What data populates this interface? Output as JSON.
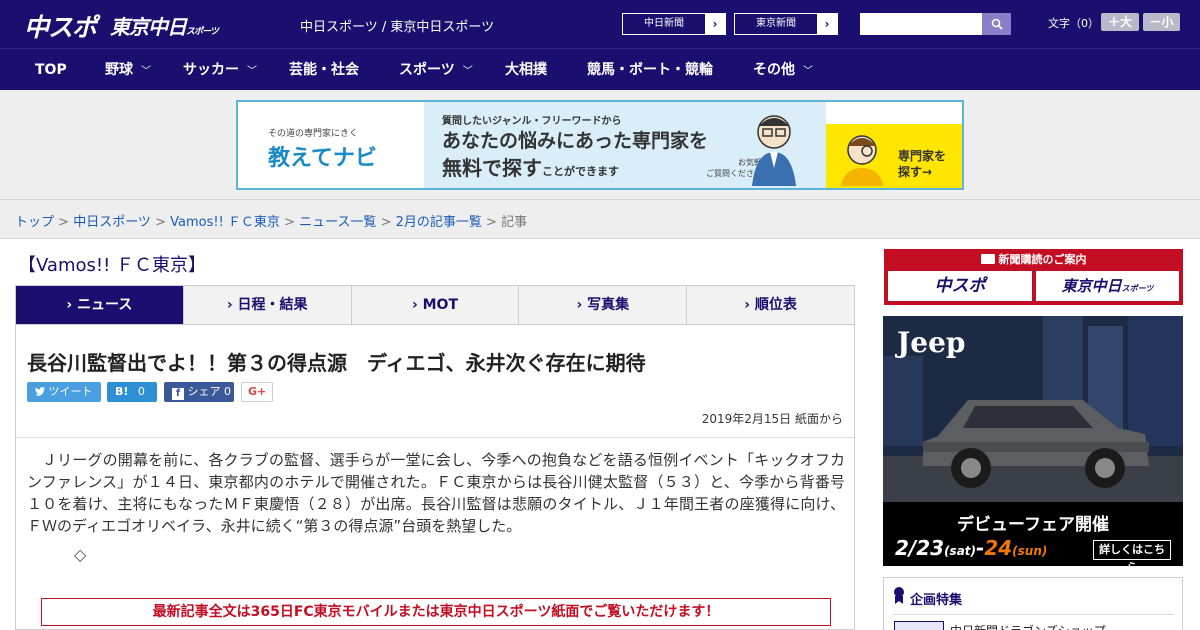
{
  "header": {
    "logo_chuspo": "中スポ",
    "logo_tokyo": "東京中日",
    "logo_tokyo_small": "スポーツ",
    "site_name": "中日スポーツ / 東京中日スポーツ",
    "links": [
      {
        "label": "中日新聞",
        "arrow": "›"
      },
      {
        "label": "東京新聞",
        "arrow": "›"
      }
    ],
    "search_placeholder": "",
    "font_label": "文字（0）",
    "font_larger": "＋大",
    "font_smaller": "－小"
  },
  "nav": {
    "items": [
      {
        "label": "TOP",
        "has_menu": false
      },
      {
        "label": "野球",
        "has_menu": true
      },
      {
        "label": "サッカー",
        "has_menu": true
      },
      {
        "label": "芸能・社会",
        "has_menu": false
      },
      {
        "label": "スポーツ",
        "has_menu": true
      },
      {
        "label": "大相撲",
        "has_menu": false
      },
      {
        "label": "競馬・ボート・競輪",
        "has_menu": false
      },
      {
        "label": "その他",
        "has_menu": true
      }
    ],
    "chevron": "﹀"
  },
  "ad_banner": {
    "tagline": "その道の専門家にきく",
    "brand": "教えてナビ",
    "line1": "質問したいジャンル・フリーワードから",
    "line2": "あなたの悩みにあった専門家を",
    "line3_main": "無料で探す",
    "line3_small": "ことができます",
    "note": "お気軽に\nご質問ください！",
    "cta": "専門家を\n探す→"
  },
  "breadcrumb": {
    "items": [
      "トップ",
      "中日スポーツ",
      "Vamos!! ＦＣ東京",
      "ニュース一覧",
      "2月の記事一覧"
    ],
    "current": "記事",
    "separator": " > "
  },
  "section": {
    "title": "【Vamos!! ＦＣ東京】"
  },
  "tabs": [
    {
      "label": "ニュース",
      "active": true
    },
    {
      "label": "日程・結果",
      "active": false
    },
    {
      "label": "MOT",
      "active": false
    },
    {
      "label": "写真集",
      "active": false
    },
    {
      "label": "順位表",
      "active": false
    }
  ],
  "tab_marker": "›",
  "article": {
    "title": "長谷川監督出でよ！！第３の得点源　ディエゴ、永井次ぐ存在に期待",
    "share": {
      "tweet": "ツイート",
      "hatena_count": "0",
      "facebook": "シェア",
      "facebook_count": "0",
      "gplus": "G+"
    },
    "date": "2019年2月15日 紙面から",
    "body": "Ｊリーグの開幕を前に、各クラブの監督、選手らが一堂に会し、今季への抱負などを語る恒例イベント「キックオフカンファレンス」が１４日、東京都内のホテルで開催された。ＦＣ東京からは長谷川健太監督（５３）と、今季から背番号１０を着け、主将にもなったＭＦ東慶悟（２８）が出席。長谷川監督は悲願のタイトル、Ｊ１年間王者の座獲得に向け、ＦＷのディエゴオリベイラ、永井に続く“第３の得点源”台頭を熱望した。",
    "separator_glyph": "◇",
    "notice": "最新記事全文は365日FC東京モバイルまたは東京中日スポーツ紙面でご覧いただけます！"
  },
  "sidebar": {
    "subscribe_title": "新聞購読のご案内",
    "subscribe_logos": [
      "中スポ",
      "東京中日"
    ],
    "subscribe_logo_small": "スポーツ",
    "jeep": {
      "brand": "Jeep",
      "fair": "デビューフェア開催",
      "date_start": "2/23",
      "date_start_day": "(sat)",
      "date_end": "24",
      "date_end_day": "(sun)",
      "details": "詳しくはこちら"
    },
    "feature_title": "企画特集",
    "feature_item": "中日新聞ドラゴンズショップ"
  },
  "colors": {
    "header_bg": "#1a0f6e",
    "accent_red": "#c30d23",
    "banner_border": "#5ab4dc",
    "link": "#1a5bb5"
  }
}
